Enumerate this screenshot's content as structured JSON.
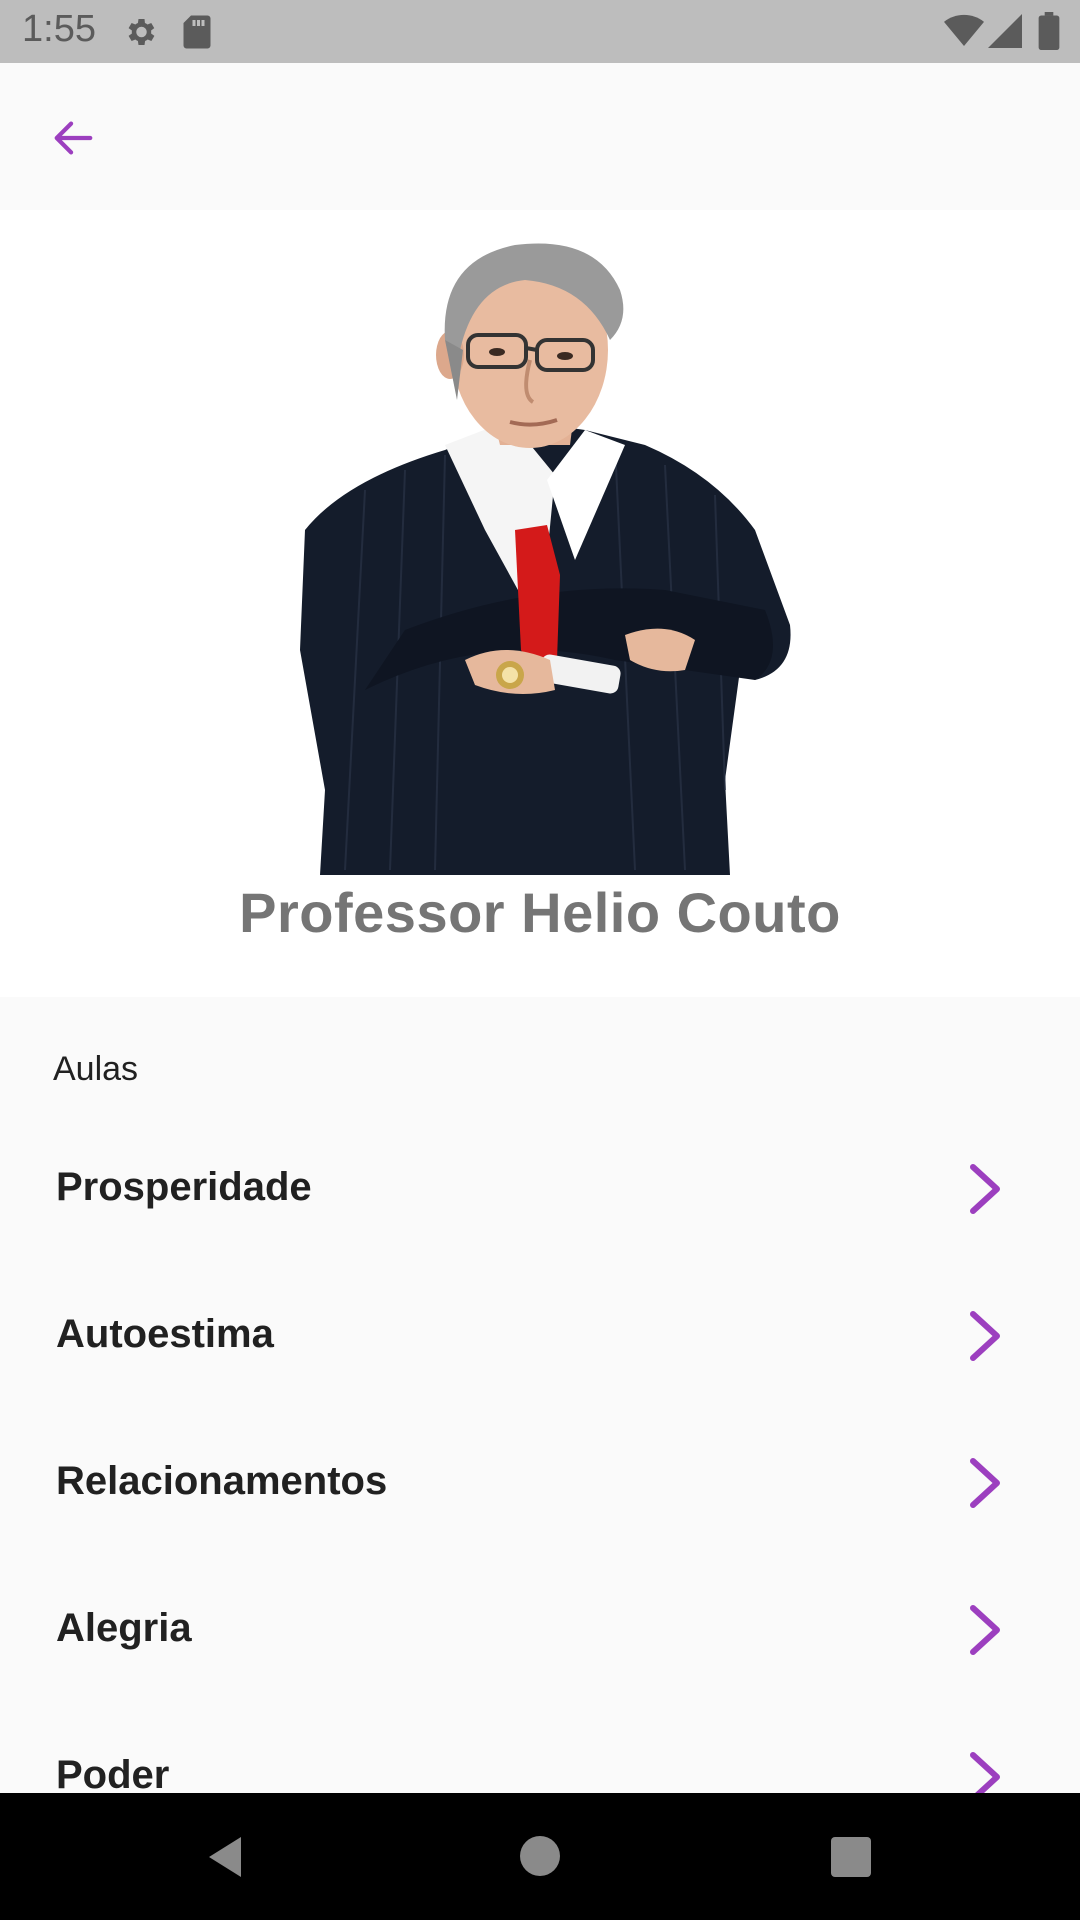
{
  "status_bar": {
    "time": "1:55",
    "icons": [
      "settings-gear-icon",
      "sd-card-icon",
      "wifi-icon",
      "cell-signal-icon",
      "battery-icon"
    ]
  },
  "app_bar": {
    "back_icon": "arrow-left-icon",
    "accent_color": "#9c3fbf"
  },
  "profile": {
    "name": "Professor Helio Couto",
    "photo": "portrait-photo"
  },
  "section": {
    "label": "Aulas"
  },
  "lessons": [
    {
      "label": "Prosperidade"
    },
    {
      "label": "Autoestima"
    },
    {
      "label": "Relacionamentos"
    },
    {
      "label": "Alegria"
    },
    {
      "label": "Poder"
    }
  ],
  "nav_bar": {
    "buttons": [
      "back-triangle-icon",
      "home-circle-icon",
      "recents-square-icon"
    ]
  }
}
